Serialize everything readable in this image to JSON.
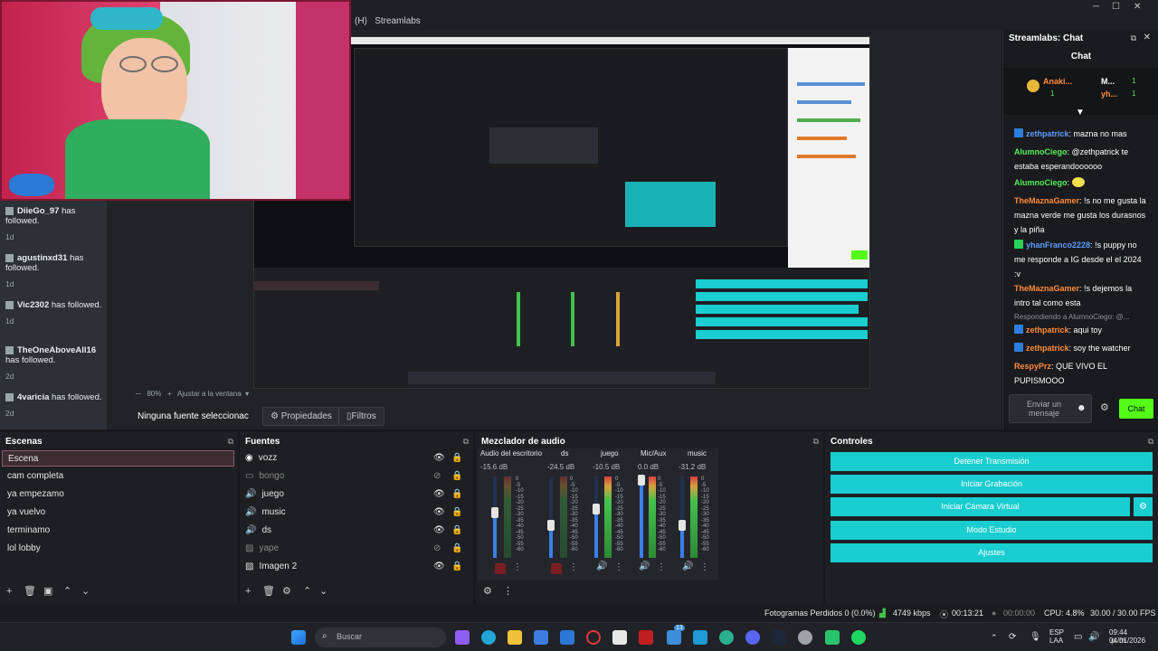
{
  "window": {
    "title": "Streamlabs",
    "title_prefix": "(H)"
  },
  "activity": [
    {
      "user": "DiieGo_97",
      "text": "has followed.",
      "time": "1d"
    },
    {
      "user": "agustinxd31",
      "text": "has followed.",
      "time": "1d"
    },
    {
      "user": "Vic2302",
      "text": "has followed.",
      "time": "1d"
    },
    {
      "user": "TheOneAboveAll16",
      "text": "has followed.",
      "time": "2d"
    },
    {
      "user": "4varicia",
      "text": "has followed.",
      "time": "2d"
    }
  ],
  "preview": {
    "zoom": "80%",
    "fit": "Ajustar a la ventana",
    "no_source": "Ninguna fuente seleccionac",
    "properties": "Propiedades",
    "filters": "Filtros"
  },
  "chat": {
    "window_title": "Streamlabs: Chat",
    "title": "Chat",
    "top_users": [
      "Anaki...",
      "M...",
      "yh..."
    ],
    "top_counts": [
      "1",
      "1",
      "1"
    ],
    "messages": [
      {
        "user": "zethpatrick",
        "color": "blue",
        "text": "mazna no mas"
      },
      {
        "user": "AlumnoCiego",
        "color": "green",
        "text": "@zethpatrick te estaba esperandoooooo"
      },
      {
        "user": "AlumnoCiego",
        "color": "green",
        "text": ""
      },
      {
        "user": "TheMaznaGamer",
        "color": "orange",
        "text": "!s no me gusta la mazna verde me gusta los durasnos y la piña"
      },
      {
        "user": "yhanFranco2228",
        "color": "blue",
        "text": "!s puppy no me responde a IG desde el el 2024 :v"
      },
      {
        "user": "TheMaznaGamer",
        "color": "orange",
        "text": "!s dejemos la intro tal como esta"
      },
      {
        "user": "",
        "color": "grey",
        "text": "Respondiendo a AlumnoCiego: @..."
      },
      {
        "user": "zethpatrick",
        "color": "orange",
        "text": "aqui toy"
      },
      {
        "user": "zethpatrick",
        "color": "orange",
        "text": "soy the watcher"
      },
      {
        "user": "RespyPrz",
        "color": "orange",
        "text": "QUE VIVO EL PUPISMOOO"
      }
    ],
    "input_placeholder": "Enviar un mensaje",
    "send": "Chat"
  },
  "scenes": {
    "title": "Escenas",
    "items": [
      "Escena",
      "cam completa",
      "ya empezamo",
      "ya vuelvo",
      "terminamo",
      "lol lobby"
    ]
  },
  "sources": {
    "title": "Fuentes",
    "items": [
      {
        "name": "vozz",
        "icon": "audio-icon",
        "hidden": false
      },
      {
        "name": "bongo",
        "icon": "window-icon",
        "hidden": true
      },
      {
        "name": "juego",
        "icon": "speaker-icon",
        "hidden": false
      },
      {
        "name": "music",
        "icon": "speaker-icon",
        "hidden": false
      },
      {
        "name": "ds",
        "icon": "speaker-icon",
        "hidden": false
      },
      {
        "name": "yape",
        "icon": "image-icon",
        "hidden": true
      },
      {
        "name": "Imagen 2",
        "icon": "image-icon",
        "hidden": false
      }
    ]
  },
  "mixer": {
    "title": "Mezclador de audio",
    "channels": [
      {
        "name": "Audio del escritorio",
        "db": "-15.6 dB",
        "level": 0.55,
        "muted": true
      },
      {
        "name": "ds",
        "db": "-24.5 dB",
        "level": 0.4,
        "muted": true
      },
      {
        "name": "juego",
        "db": "-10.5 dB",
        "level": 0.6,
        "muted": false
      },
      {
        "name": "Mic/Aux",
        "db": "0.0 dB",
        "level": 0.95,
        "muted": false
      },
      {
        "name": "music",
        "db": "-31.2 dB",
        "level": 0.4,
        "muted": false
      }
    ],
    "scale": [
      "0",
      "-5",
      "-10",
      "-15",
      "-20",
      "-25",
      "-30",
      "-35",
      "-40",
      "-45",
      "-50",
      "-55",
      "-60"
    ]
  },
  "controls": {
    "title": "Controles",
    "buttons": [
      "Detener Transmisión",
      "Iniciar Grabación",
      "Iniciar Cámara Virtual",
      "Modo Estudio",
      "Ajustes"
    ]
  },
  "status": {
    "dropped": "Fotogramas Perdidos 0 (0.0%)",
    "bitrate": "4749 kbps",
    "stream_time": "00:13:21",
    "rec_time": "00:00:00",
    "cpu": "CPU: 4.8%",
    "fps": "30.00 / 30.00 FPS"
  },
  "taskbar": {
    "search": "Buscar",
    "lang": "ESP",
    "lang2": "LAA",
    "time": "09:44 p. m.",
    "date": "04/01/2026",
    "badge": "13"
  },
  "colors": {
    "accent": "#19cdd0",
    "chat_send": "#53fc18",
    "selected_scene": "#3c2d33"
  }
}
